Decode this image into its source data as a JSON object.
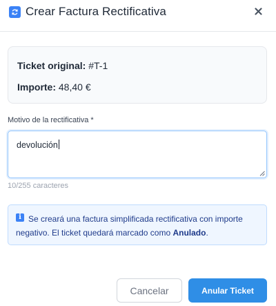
{
  "dialog": {
    "title": "Crear Factura Rectificativa",
    "header_icon": "refresh-icon",
    "close_icon": "close-icon"
  },
  "ticket": {
    "original_label": "Ticket original:",
    "original_value": "#T-1",
    "amount_label": "Importe:",
    "amount_value": "48,40 €"
  },
  "reason": {
    "label": "Motivo de la rectificativa *",
    "value": "devolución",
    "counter": "10/255 caracteres"
  },
  "notice": {
    "icon": "info-icon",
    "text_before": "Se creará una factura simplificada rectificativa con importe negativo. El ticket quedará marcado como ",
    "highlight": "Anulado",
    "text_after": "."
  },
  "actions": {
    "cancel_label": "Cancelar",
    "confirm_label": "Anular Ticket"
  },
  "colors": {
    "accent": "#2f8ee6",
    "icon_blue": "#3b82f6",
    "notice_bg": "#eff6ff",
    "notice_text": "#1e3a8a"
  }
}
